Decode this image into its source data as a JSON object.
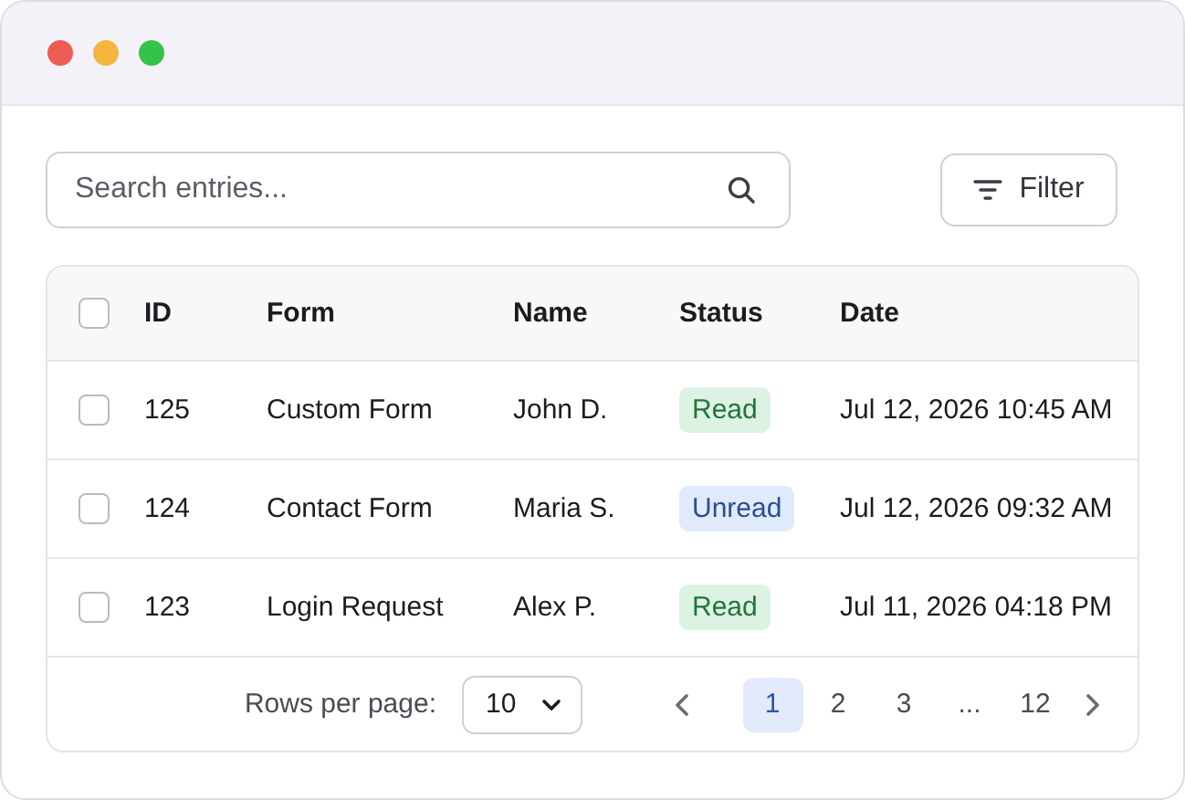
{
  "window": {
    "controls": [
      {
        "kind": "close"
      },
      {
        "kind": "minimize"
      },
      {
        "kind": "zoom"
      }
    ]
  },
  "search": {
    "placeholder": "Search entries..."
  },
  "filter_button": {
    "label": "Filter"
  },
  "table": {
    "select_all": {
      "checked": false
    },
    "columns": [
      "ID",
      "Form",
      "Name",
      "Status",
      "Date"
    ],
    "rows": [
      {
        "checked": false,
        "id": "125",
        "form": "Custom Form",
        "name": "John D.",
        "status": {
          "label": "Read",
          "kind": "read"
        },
        "date": "Jul 12, 2026 10:45 AM"
      },
      {
        "checked": false,
        "id": "124",
        "form": "Contact Form",
        "name": "Maria S.",
        "status": {
          "label": "Unread",
          "kind": "unread"
        },
        "date": "Jul 12, 2026 09:32 AM"
      },
      {
        "checked": false,
        "id": "123",
        "form": "Login Request",
        "name": "Alex P.",
        "status": {
          "label": "Read",
          "kind": "read"
        },
        "date": "Jul 11, 2026 04:18 PM"
      }
    ]
  },
  "pagination": {
    "rows_per_page_label": "Rows per page:",
    "rows_per_page": "10",
    "pages": [
      {
        "label": "1",
        "selected": true
      },
      {
        "label": "2",
        "selected": false
      },
      {
        "label": "3",
        "selected": false
      },
      {
        "label": "...",
        "selected": false
      },
      {
        "label": "12",
        "selected": false
      }
    ]
  }
}
